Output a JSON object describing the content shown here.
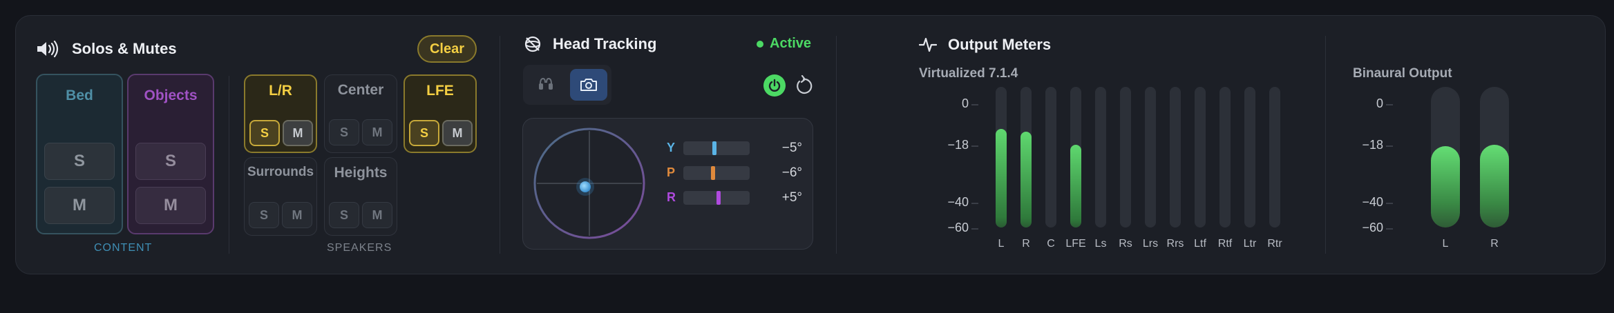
{
  "solos_mutes": {
    "title": "Solos & Mutes",
    "clear_label": "Clear",
    "content_caption": "CONTENT",
    "speakers_caption": "SPEAKERS",
    "content": {
      "bed": {
        "name": "Bed",
        "solo": "S",
        "mute": "M"
      },
      "objects": {
        "name": "Objects",
        "solo": "S",
        "mute": "M"
      }
    },
    "speakers": {
      "lr": {
        "name": "L/R",
        "solo": "S",
        "mute": "M",
        "active": true
      },
      "center": {
        "name": "Center",
        "solo": "S",
        "mute": "M",
        "active": false
      },
      "lfe": {
        "name": "LFE",
        "solo": "S",
        "mute": "M",
        "active": true
      },
      "surrounds": {
        "name": "Surrounds",
        "solo": "S",
        "mute": "M",
        "active": false
      },
      "heights": {
        "name": "Heights",
        "solo": "S",
        "mute": "M",
        "active": false
      }
    },
    "colors": {
      "bed": "#4f8fa6",
      "objects": "#a052c4",
      "solo_active": "#f4cf43",
      "content_caption": "#3f8fb5"
    }
  },
  "head_tracking": {
    "title": "Head Tracking",
    "status": "Active",
    "status_color": "#4cd964",
    "modes": [
      {
        "icon": "headphones-icon",
        "selected": false
      },
      {
        "icon": "camera-icon",
        "selected": true
      }
    ],
    "axes": [
      {
        "label": "Y",
        "value": "−5°",
        "color": "#5ab4e6",
        "position": 0.47
      },
      {
        "label": "P",
        "value": "−6°",
        "color": "#e08a3c",
        "position": 0.45
      },
      {
        "label": "R",
        "value": "+5°",
        "color": "#b04adf",
        "position": 0.53
      }
    ]
  },
  "output_meters": {
    "title": "Output Meters",
    "virtualized": {
      "label": "Virtualized 7.1.4",
      "scale": [
        "0",
        "−18",
        "−40",
        "−60"
      ],
      "channels": [
        {
          "name": "L",
          "level": 0.7
        },
        {
          "name": "R",
          "level": 0.68
        },
        {
          "name": "C",
          "level": 0
        },
        {
          "name": "LFE",
          "level": 0.59
        },
        {
          "name": "Ls",
          "level": 0
        },
        {
          "name": "Rs",
          "level": 0
        },
        {
          "name": "Lrs",
          "level": 0
        },
        {
          "name": "Rrs",
          "level": 0
        },
        {
          "name": "Ltf",
          "level": 0
        },
        {
          "name": "Rtf",
          "level": 0
        },
        {
          "name": "Ltr",
          "level": 0
        },
        {
          "name": "Rtr",
          "level": 0
        }
      ]
    },
    "binaural": {
      "label": "Binaural Output",
      "scale": [
        "0",
        "−18",
        "−40",
        "−60"
      ],
      "channels": [
        {
          "name": "L",
          "level": 0.58
        },
        {
          "name": "R",
          "level": 0.59
        }
      ]
    }
  }
}
